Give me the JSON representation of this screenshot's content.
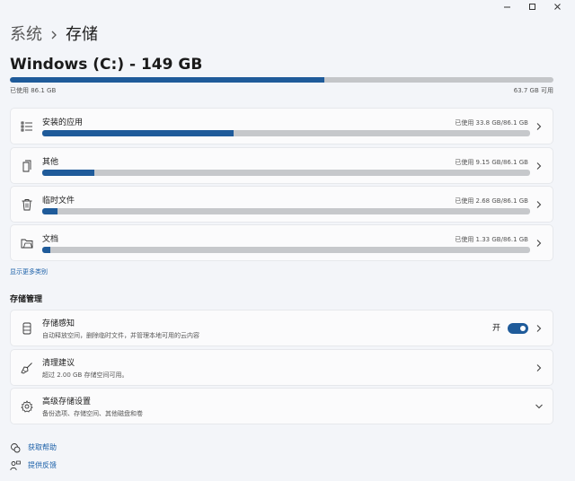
{
  "window": {
    "controls": [
      "minimize-icon",
      "maximize-icon",
      "close-icon"
    ]
  },
  "breadcrumb": {
    "parent": "系统",
    "current": "存储"
  },
  "drive": {
    "title": "Windows (C:) - 149 GB",
    "used_label": "已使用 86.1 GB",
    "free_label": "63.7 GB 可用",
    "used_fraction": 0.578
  },
  "categories": [
    {
      "label": "安装的应用",
      "usage": "已使用 33.8 GB/86.1 GB",
      "fraction": 0.393,
      "icon": "apps-list-icon"
    },
    {
      "label": "其他",
      "usage": "已使用 9.15 GB/86.1 GB",
      "fraction": 0.106,
      "icon": "file-other-icon"
    },
    {
      "label": "临时文件",
      "usage": "已使用 2.68 GB/86.1 GB",
      "fraction": 0.031,
      "icon": "trash-icon"
    },
    {
      "label": "文档",
      "usage": "已使用 1.33 GB/86.1 GB",
      "fraction": 0.016,
      "icon": "folder-icon"
    }
  ],
  "show_more": "显示更多类别",
  "management": {
    "heading": "存储管理",
    "items": [
      {
        "title": "存储感知",
        "subtitle": "自动释放空间，删除临时文件，并管理本地可用的云内容",
        "toggle_label": "开",
        "toggle_on": true,
        "icon": "storage-drive-icon"
      },
      {
        "title": "清理建议",
        "subtitle": "超过 2.00 GB 存储空间可用。",
        "icon": "broom-icon"
      },
      {
        "title": "高级存储设置",
        "subtitle": "备份选项、存储空间、其他磁盘和卷",
        "icon": "gear-icon"
      }
    ]
  },
  "footer": {
    "help": "获取帮助",
    "feedback": "提供反馈"
  },
  "colors": {
    "accent": "#1f5b9a",
    "bar_track": "#c6c8cb",
    "link": "#1a5fa8"
  }
}
